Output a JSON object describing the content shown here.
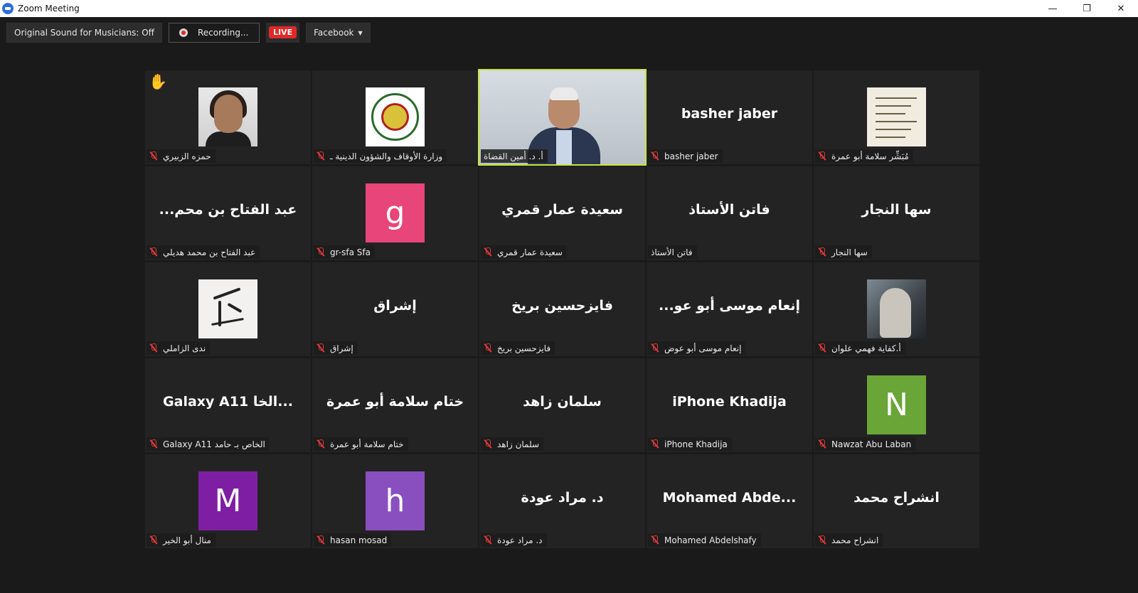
{
  "window": {
    "title": "Zoom Meeting",
    "controls": [
      "—",
      "❐",
      "✕"
    ]
  },
  "toolbar": {
    "original_sound": "Original Sound for Musicians: Off",
    "recording": "Recording...",
    "live": "LIVE",
    "stream_target": "Facebook"
  },
  "colors": {
    "active_border": "#c6e63e",
    "mute_red": "#e53939",
    "live_red": "#e02828"
  },
  "tiles": [
    {
      "label": "حمزه الزبيري",
      "muted": true,
      "type": "photo-person",
      "hand_raised": true
    },
    {
      "label": "وزارة الأوقاف والشؤون الدينية ـ",
      "muted": true,
      "type": "photo-seal"
    },
    {
      "label": "أ. د. أمين القضاة",
      "muted": false,
      "type": "video",
      "active": true
    },
    {
      "label": "basher jaber",
      "big": "basher jaber",
      "muted": true,
      "type": "name"
    },
    {
      "label": "مُبَشِّر سلامة أبو عمرة",
      "muted": true,
      "type": "photo-paper"
    },
    {
      "label": "عبد الفتاح بن محمد هديلي",
      "big": "...عبد الفتاح بن محم",
      "muted": true,
      "type": "name"
    },
    {
      "label": "gr-sfa Sfa",
      "letter": "g",
      "color": "#e8457a",
      "muted": true,
      "type": "letter"
    },
    {
      "label": "سعيدة عمار قمري",
      "big": "سعيدة عمار قمري",
      "muted": true,
      "type": "name"
    },
    {
      "label": "فاتن الأستاذ",
      "big": "فاتن الأستاذ",
      "muted": false,
      "type": "name"
    },
    {
      "label": "سها النجار",
      "big": "سها النجار",
      "muted": true,
      "type": "name"
    },
    {
      "label": "ندى الزاملي",
      "muted": true,
      "type": "photo-cal"
    },
    {
      "label": "إشراق",
      "big": "إشراق",
      "muted": true,
      "type": "name"
    },
    {
      "label": "فايزحسين بريخ",
      "big": "فايزحسين بريخ",
      "muted": true,
      "type": "name"
    },
    {
      "label": "إنعام موسى أبو عوض",
      "big": "...إنعام موسى أبو عو",
      "muted": true,
      "type": "name"
    },
    {
      "label": "أ.كفاية فهمي علوان",
      "muted": true,
      "type": "photo-room"
    },
    {
      "label": "Galaxy A11 الخاص بـ حامد",
      "big": "Galaxy A11 الخا...",
      "muted": true,
      "type": "name"
    },
    {
      "label": "ختام سلامة أبو عمرة",
      "big": "ختام سلامة أبو عمرة",
      "muted": true,
      "type": "name"
    },
    {
      "label": "سلمان زاهد",
      "big": "سلمان زاهد",
      "muted": true,
      "type": "name"
    },
    {
      "label": "iPhone Khadija",
      "big": "iPhone Khadija",
      "muted": true,
      "type": "name"
    },
    {
      "label": "Nawzat Abu Laban",
      "letter": "N",
      "color": "#6aa637",
      "muted": true,
      "type": "letter"
    },
    {
      "label": "منال أبو الخير",
      "letter": "M",
      "color": "#7e1fa3",
      "muted": true,
      "type": "letter"
    },
    {
      "label": "hasan mosad",
      "letter": "h",
      "color": "#8a4fbf",
      "muted": true,
      "type": "letter"
    },
    {
      "label": "د. مراد عودة",
      "big": "د. مراد عودة",
      "muted": true,
      "type": "name"
    },
    {
      "label": "Mohamed Abdelshafy",
      "big": "Mohamed  Abde...",
      "muted": true,
      "type": "name"
    },
    {
      "label": "انشراح محمد",
      "big": "انشراح محمد",
      "muted": true,
      "type": "name"
    }
  ]
}
